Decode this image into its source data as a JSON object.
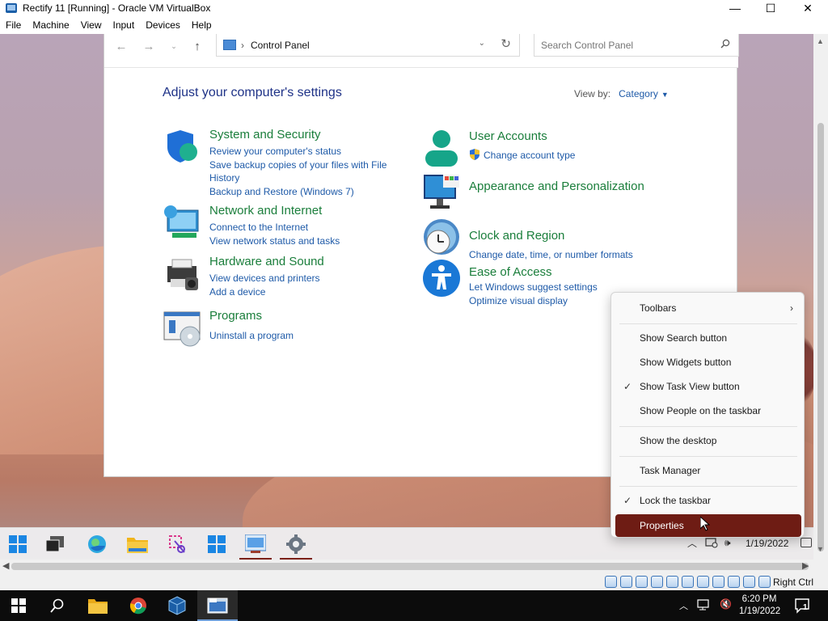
{
  "vbox": {
    "title": "Rectify 11 [Running] - Oracle VM VirtualBox",
    "menu": [
      "File",
      "Machine",
      "View",
      "Input",
      "Devices",
      "Help"
    ],
    "window_controls": {
      "minimize": "—",
      "maximize": "☐",
      "close": "✕"
    },
    "status_right": "Right Ctrl"
  },
  "control_panel": {
    "address": "Control Panel",
    "search_placeholder": "Search Control Panel",
    "heading": "Adjust your computer's settings",
    "view_by_label": "View by:",
    "view_by_value": "Category",
    "categories": [
      {
        "title": "System and Security",
        "links": [
          "Review your computer's status",
          "Save backup copies of your files with File",
          "History",
          "Backup and Restore (Windows 7)"
        ],
        "icon": "shield-icon"
      },
      {
        "title": "Network and Internet",
        "links": [
          "Connect to the Internet",
          "View network status and tasks"
        ],
        "icon": "network-icon"
      },
      {
        "title": "Hardware and Sound",
        "links": [
          "View devices and printers",
          "Add a device"
        ],
        "icon": "printer-icon"
      },
      {
        "title": "Programs",
        "links": [
          "Uninstall a program"
        ],
        "icon": "programs-icon"
      },
      {
        "title": "User Accounts",
        "links": [
          "Change account type"
        ],
        "icon": "user-icon"
      },
      {
        "title": "Appearance and Personalization",
        "links": [],
        "icon": "monitor-icon"
      },
      {
        "title": "Clock and Region",
        "links": [
          "Change date, time, or number formats"
        ],
        "icon": "clock-icon"
      },
      {
        "title": "Ease of Access",
        "links": [
          "Let Windows suggest settings",
          "Optimize visual display"
        ],
        "icon": "accessibility-icon"
      }
    ]
  },
  "context_menu": {
    "items": [
      {
        "label": "Toolbars",
        "has_submenu": true,
        "checked": false
      },
      {
        "label": "Show Search button",
        "checked": false
      },
      {
        "label": "Show Widgets button",
        "checked": false
      },
      {
        "label": "Show Task View button",
        "checked": true
      },
      {
        "label": "Show People on the taskbar",
        "checked": false
      },
      {
        "label": "Show the desktop",
        "checked": false
      },
      {
        "label": "Task Manager",
        "checked": false
      },
      {
        "label": "Lock the taskbar",
        "checked": true
      },
      {
        "label": "Properties",
        "checked": false,
        "highlighted": true
      }
    ],
    "highlight_color": "#6e1c14"
  },
  "guest_taskbar": {
    "icons": [
      "windows-start-icon",
      "task-view-icon",
      "edge-icon",
      "file-explorer-icon",
      "snipping-tool-icon",
      "windows-icon",
      "control-panel-icon",
      "settings-icon"
    ],
    "date": "1/19/2022"
  },
  "host_taskbar": {
    "icons": [
      "start-icon",
      "search-icon",
      "file-explorer-icon",
      "chrome-icon",
      "virtualbox-icon",
      "virtualbox-vm-icon"
    ],
    "time": "6:20 PM",
    "date": "1/19/2022",
    "notification_count": "1"
  },
  "colors": {
    "link": "#1e5aa8",
    "category_title": "#1a7e3b",
    "heading": "#1e3287"
  }
}
